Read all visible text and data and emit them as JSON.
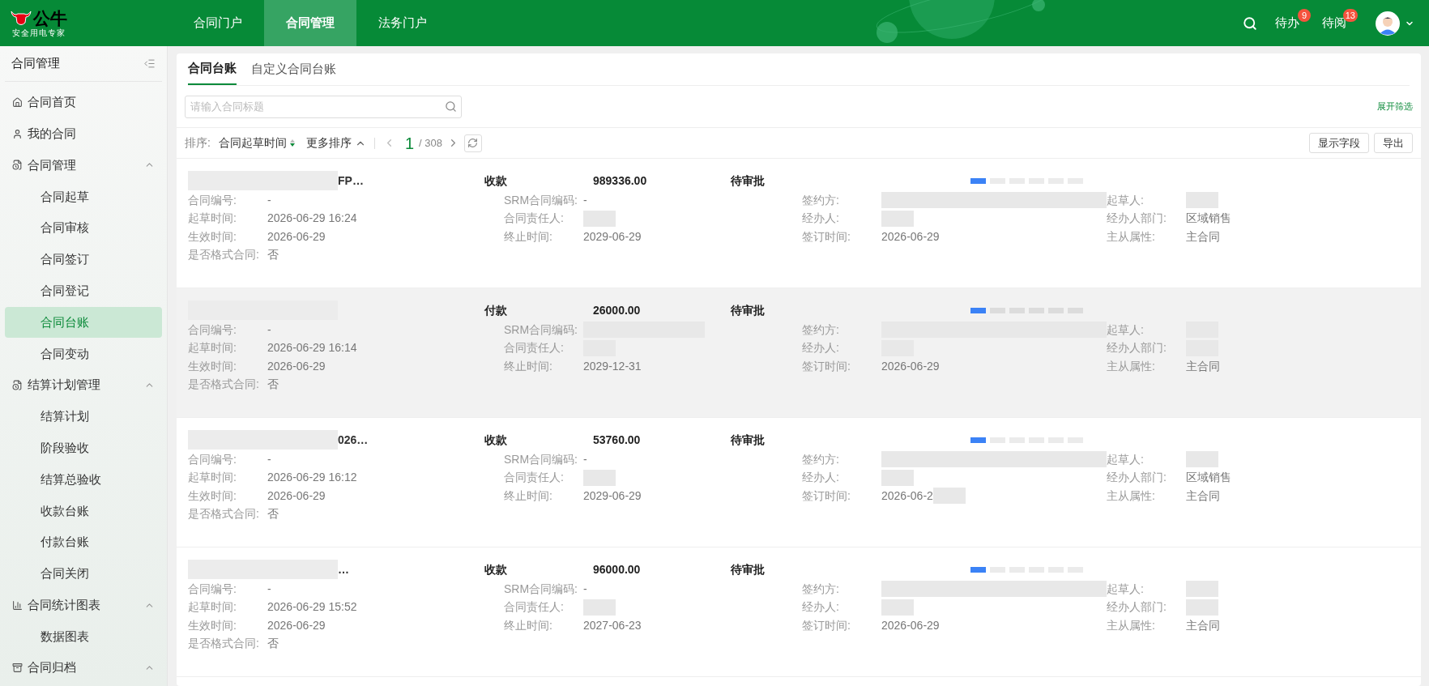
{
  "header": {
    "logo_text": "公牛",
    "logo_slogan": "安全用电专家",
    "nav": [
      {
        "label": "合同门户",
        "selected": false
      },
      {
        "label": "合同管理",
        "selected": true
      },
      {
        "label": "法务门户",
        "selected": false
      }
    ],
    "todo": {
      "label": "待办",
      "count": "9"
    },
    "toread": {
      "label": "待阅",
      "count": "13"
    }
  },
  "sidebar": {
    "title": "合同管理",
    "items": [
      {
        "label": "合同首页",
        "selected": false
      },
      {
        "label": "我的合同",
        "selected": false
      },
      {
        "label": "合同管理",
        "selected": false,
        "expanded": true,
        "children": [
          {
            "label": "合同起草",
            "selected": false
          },
          {
            "label": "合同审核",
            "selected": false
          },
          {
            "label": "合同签订",
            "selected": false
          },
          {
            "label": "合同登记",
            "selected": false
          },
          {
            "label": "合同台账",
            "selected": true
          },
          {
            "label": "合同变动",
            "selected": false
          }
        ]
      },
      {
        "label": "结算计划管理",
        "selected": false,
        "expanded": true,
        "children": [
          {
            "label": "结算计划",
            "selected": false
          },
          {
            "label": "阶段验收",
            "selected": false
          },
          {
            "label": "结算总验收",
            "selected": false
          },
          {
            "label": "收款台账",
            "selected": false
          },
          {
            "label": "付款台账",
            "selected": false
          },
          {
            "label": "合同关闭",
            "selected": false
          }
        ]
      },
      {
        "label": "合同统计图表",
        "selected": false,
        "expanded": true,
        "children": [
          {
            "label": "数据图表",
            "selected": false
          }
        ]
      },
      {
        "label": "合同归档",
        "selected": false,
        "expanded": true
      }
    ]
  },
  "tabs": [
    {
      "label": "合同台账",
      "selected": true
    },
    {
      "label": "自定义合同台账",
      "selected": false
    }
  ],
  "search": {
    "placeholder": "请输入合同标题"
  },
  "filter_link": "展开筛选",
  "toolbar": {
    "sort_label": "排序:",
    "sort_field": "合同起草时间",
    "more_sort": "更多排序",
    "page": "1",
    "total": "/ 308",
    "buttons": [
      "显示字段",
      "导出"
    ]
  },
  "contracts": [
    {
      "title": "FP…",
      "type": "收款",
      "amount": "989336.00",
      "status": "待审批",
      "highlighted": false,
      "steps": [
        {
          "done": true
        },
        {
          "done": false
        },
        {
          "done": false
        },
        {
          "done": false
        },
        {
          "done": false
        },
        {
          "done": false
        }
      ],
      "fields": [
        {
          "label": "合同编号:",
          "value": "-",
          "redacted": false
        },
        {
          "label": "SRM合同编码:",
          "value": "-",
          "redacted": false
        },
        {
          "label": "签约方:",
          "redacted": true
        },
        {
          "label": "起草人:",
          "redacted": true
        },
        {
          "label": "起草时间:",
          "value": "2026-06-29 16:24",
          "redacted": false
        },
        {
          "label": "合同责任人:",
          "redacted": true
        },
        {
          "label": "经办人:",
          "redacted": true
        },
        {
          "label": "经办人部门:",
          "value": "区域销售",
          "redacted": false
        },
        {
          "label": "生效时间:",
          "value": "2026-06-29",
          "redacted": false
        },
        {
          "label": "终止时间:",
          "value": "2029-06-29",
          "redacted": false
        },
        {
          "label": "签订时间:",
          "value": "2026-06-29",
          "redacted": false
        },
        {
          "label": "主从属性:",
          "value": "主合同",
          "redacted": false
        },
        {
          "label": "是否格式合同:",
          "value": "否",
          "redacted": false
        }
      ]
    },
    {
      "type": "付款",
      "amount": "26000.00",
      "status": "待审批",
      "highlighted": true,
      "steps": [
        {
          "done": true
        },
        {
          "done": false
        },
        {
          "done": false
        },
        {
          "done": false
        },
        {
          "done": false
        },
        {
          "done": false
        }
      ],
      "fields": [
        {
          "label": "合同编号:",
          "value": "-",
          "redacted": false
        },
        {
          "label": "SRM合同编码:",
          "redacted": true
        },
        {
          "label": "签约方:",
          "redacted": true
        },
        {
          "label": "起草人:",
          "redacted": true
        },
        {
          "label": "起草时间:",
          "value": "2026-06-29 16:14",
          "redacted": false
        },
        {
          "label": "合同责任人:",
          "redacted": true
        },
        {
          "label": "经办人:",
          "redacted": true
        },
        {
          "label": "经办人部门:",
          "redacted": true
        },
        {
          "label": "生效时间:",
          "value": "2026-06-29",
          "redacted": false
        },
        {
          "label": "终止时间:",
          "value": "2029-12-31",
          "redacted": false
        },
        {
          "label": "签订时间:",
          "value": "2026-06-29",
          "redacted": false
        },
        {
          "label": "主从属性:",
          "value": "主合同",
          "redacted": false
        },
        {
          "label": "是否格式合同:",
          "value": "否",
          "redacted": false
        }
      ]
    },
    {
      "title": "026…",
      "type": "收款",
      "amount": "53760.00",
      "status": "待审批",
      "highlighted": false,
      "steps": [
        {
          "done": true
        },
        {
          "done": false
        },
        {
          "done": false
        },
        {
          "done": false
        },
        {
          "done": false
        },
        {
          "done": false
        }
      ],
      "fields": [
        {
          "label": "合同编号:",
          "value": "-",
          "redacted": false
        },
        {
          "label": "SRM合同编码:",
          "value": "-",
          "redacted": false
        },
        {
          "label": "签约方:",
          "redacted": true
        },
        {
          "label": "起草人:",
          "redacted": true
        },
        {
          "label": "起草时间:",
          "value": "2026-06-29 16:12",
          "redacted": false
        },
        {
          "label": "合同责任人:",
          "redacted": true
        },
        {
          "label": "经办人:",
          "redacted": true
        },
        {
          "label": "经办人部门:",
          "value": "区域销售",
          "redacted": false
        },
        {
          "label": "生效时间:",
          "value": "2026-06-29",
          "redacted": false
        },
        {
          "label": "终止时间:",
          "value": "2029-06-29",
          "redacted": false
        },
        {
          "label": "签订时间:",
          "value": "2026-06-2",
          "redacted": true
        },
        {
          "label": "主从属性:",
          "value": "主合同",
          "redacted": false
        },
        {
          "label": "是否格式合同:",
          "value": "否",
          "redacted": false
        }
      ]
    },
    {
      "title": "…",
      "type": "收款",
      "amount": "96000.00",
      "status": "待审批",
      "highlighted": false,
      "steps": [
        {
          "done": true
        },
        {
          "done": false
        },
        {
          "done": false
        },
        {
          "done": false
        },
        {
          "done": false
        },
        {
          "done": false
        }
      ],
      "fields": [
        {
          "label": "合同编号:",
          "value": "-",
          "redacted": false
        },
        {
          "label": "SRM合同编码:",
          "value": "-",
          "redacted": false
        },
        {
          "label": "签约方:",
          "redacted": true
        },
        {
          "label": "起草人:",
          "redacted": true
        },
        {
          "label": "起草时间:",
          "value": "2026-06-29 15:52",
          "redacted": false
        },
        {
          "label": "合同责任人:",
          "redacted": true
        },
        {
          "label": "经办人:",
          "redacted": true
        },
        {
          "label": "经办人部门:",
          "redacted": true
        },
        {
          "label": "生效时间:",
          "value": "2026-06-29",
          "redacted": false
        },
        {
          "label": "终止时间:",
          "value": "2027-06-23",
          "redacted": false
        },
        {
          "label": "签订时间:",
          "value": "2026-06-29",
          "redacted": false
        },
        {
          "label": "主从属性:",
          "value": "主合同",
          "redacted": false
        },
        {
          "label": "是否格式合同:",
          "value": "否",
          "redacted": false
        }
      ]
    }
  ]
}
